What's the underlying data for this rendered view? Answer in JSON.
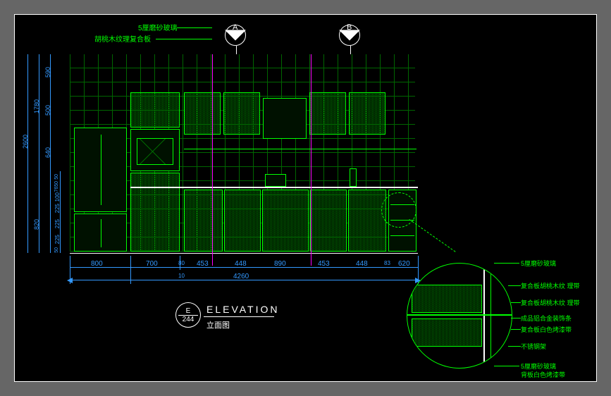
{
  "annotations": {
    "top_left_note": "5厘磨砂玻璃",
    "top_left_note2": "胡桃木纹理复合板"
  },
  "section_markers": {
    "a": "A",
    "b": "B"
  },
  "dimensions": {
    "overall_height": "2600",
    "upper_span": "1780",
    "lower_span": "820",
    "top_gap": "590",
    "upper_cab": "500",
    "mid1": "640",
    "mid2": "50",
    "mid3": "7650",
    "lower1": "100",
    "lower2": "225",
    "lower3": "225",
    "lower4": "225",
    "lower5": "50",
    "overall_width": "4260",
    "w_fridge": "800",
    "w_tall": "700",
    "w_sp1": "80",
    "w_c1": "453",
    "w_c2": "448",
    "w_c3": "890",
    "w_c4": "453",
    "w_c5": "448",
    "w_sp2": "83",
    "w_end": "620",
    "row2_a": "10"
  },
  "title_block": {
    "letter": "E",
    "sheet": "244",
    "title_en": "ELEVATION",
    "title_cn": "立面图"
  },
  "detail_labels": {
    "d1": "5厘磨砂玻璃",
    "d2": "复合板胡桃木纹 理带",
    "d3": "复合板胡桃木纹 理带",
    "d4": "成品铝合金装饰条",
    "d5": "复合板白色烤漆带",
    "d6": "不锈钢架",
    "d7": "5厘磨砂玻璃",
    "d8": "背板白色烤漆带"
  }
}
